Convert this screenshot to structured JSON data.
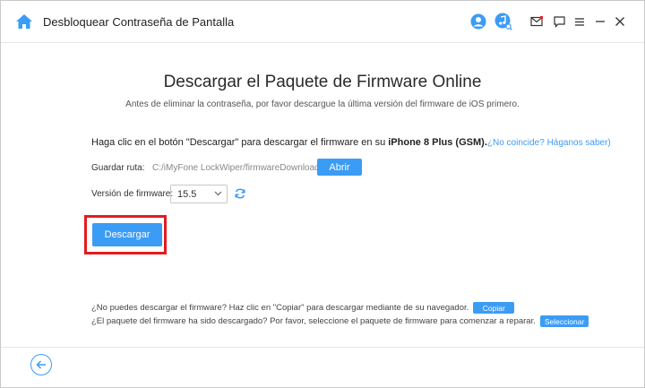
{
  "header": {
    "title": "Desbloquear Contraseña de Pantalla",
    "icons": [
      "home-icon",
      "account-icon",
      "music-search-icon",
      "mail-icon",
      "chat-icon",
      "menu-icon",
      "minimize-icon",
      "close-icon"
    ]
  },
  "main": {
    "title": "Descargar el Paquete de Firmware Online",
    "subtitle": "Antes de eliminar la contraseña, por favor descargue la última versión del firmware de iOS primero.",
    "instruction_prefix": "Haga clic en el botón \"Descargar\" para descargar el firmware en su ",
    "device": "iPhone 8 Plus (GSM).",
    "mismatch_link": "¿No coincide? Háganos saber)",
    "save_path_label": "Guardar ruta:",
    "save_path_value": "C:/iMyFone LockWiper/firmwareDownload/",
    "open_button": "Abrir",
    "firmware_version_label": "Versión de firmware:",
    "firmware_version_value": "15.5",
    "download_button": "Descargar"
  },
  "help": {
    "line1_text": "¿No puedes descargar el firmware? Haz clic en \"Copiar\" para descargar mediante de su navegador.",
    "copy_button": "Copiar",
    "line2_text": "¿El paquete del firmware ha sido descargado? Por favor, seleccione el paquete de firmware para comenzar a reparar.",
    "select_button": "Seleccionar"
  },
  "colors": {
    "accent": "#3b9cf5",
    "highlight": "#e41c1c"
  }
}
